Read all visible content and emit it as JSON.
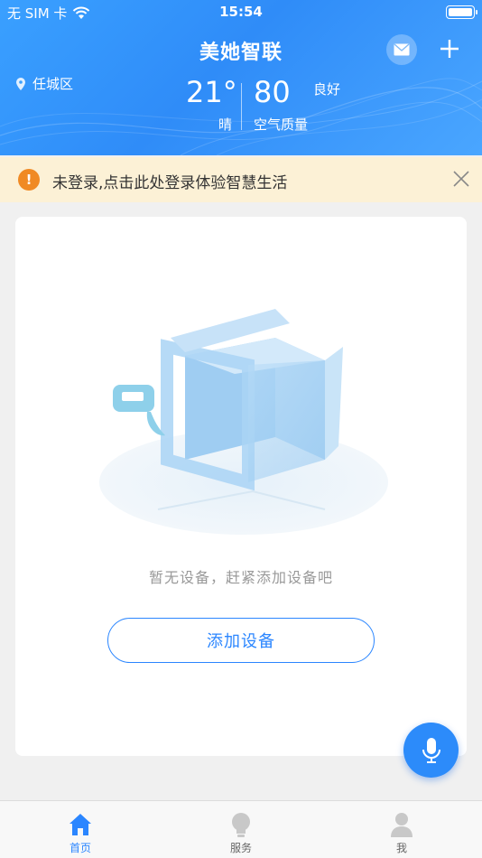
{
  "status_bar": {
    "carrier": "无 SIM 卡",
    "time": "15:54"
  },
  "header": {
    "title": "美她智联",
    "location": "任城区",
    "temperature": "21°",
    "weather": "晴",
    "aqi_value": "80",
    "aqi_level": "良好",
    "aqi_label": "空气质量"
  },
  "login_banner": {
    "text": "未登录,点击此处登录体验智慧生活"
  },
  "empty_state": {
    "message": "暂无设备，赶紧添加设备吧",
    "add_button_label": "添加设备"
  },
  "tabbar": {
    "items": [
      {
        "label": "首页",
        "icon": "home-icon",
        "active": true
      },
      {
        "label": "服务",
        "icon": "lightbulb-icon",
        "active": false
      },
      {
        "label": "我",
        "icon": "person-icon",
        "active": false
      }
    ]
  },
  "colors": {
    "header_blue": "#3aa0ff",
    "accent": "#2b86ff",
    "warning": "#f08a24",
    "banner_bg": "#fcf1d6"
  }
}
